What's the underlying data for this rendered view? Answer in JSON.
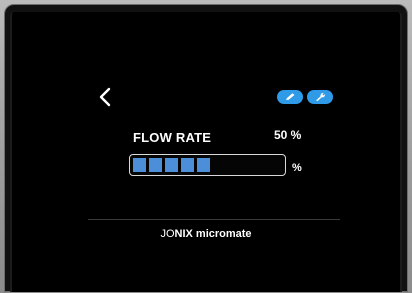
{
  "header": {
    "back_icon": "chevron-left-icon",
    "edit_icon": "pencil-icon",
    "settings_icon": "wrench-icon",
    "accent_color": "#2f9ae8"
  },
  "flow": {
    "label": "FLOW RATE",
    "value_text": "50 %",
    "unit": "%",
    "level_percent": 50,
    "segments_filled": 5,
    "segment_color": "#4c8fd8"
  },
  "brand": {
    "prefix": "JO",
    "suffix": "NIX micromate"
  }
}
